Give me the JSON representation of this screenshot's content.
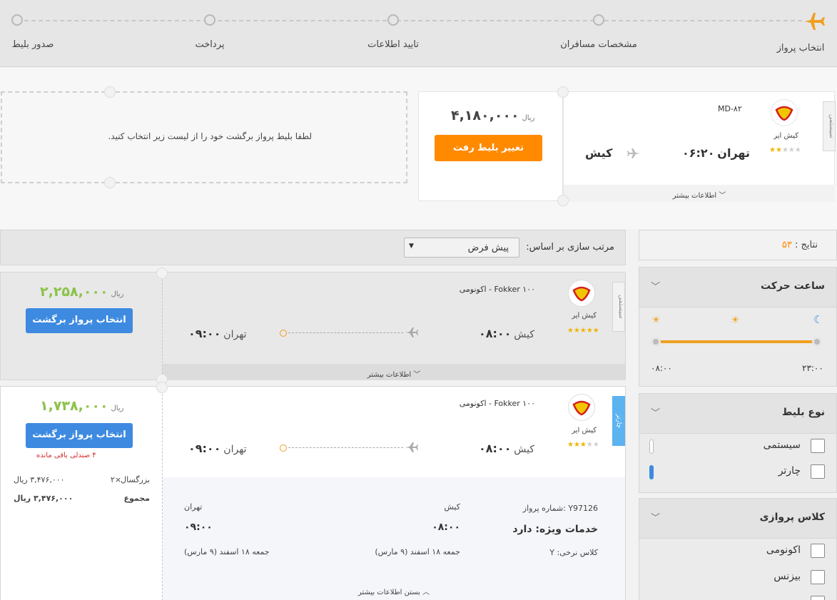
{
  "steps": [
    "انتخاب پرواز",
    "مشخصات مسافران",
    "تایید اطلاعات",
    "پرداخت",
    "صدور بلیط"
  ],
  "colors": {
    "accent": "#ff8a00",
    "primary": "#3d8ae0",
    "price": "#8bc34a",
    "charter": "#5cb3f0"
  },
  "selected_outbound": {
    "tab": "سیستمی",
    "airline": "کیش ایر",
    "aircraft": "MD-۸۲",
    "origin": "تهران",
    "time": "۰۶:۲۰",
    "destination": "کیش",
    "price": "۴,۱۸۰,۰۰۰",
    "currency": "ریال",
    "change_button": "تغییر بلیط رفت",
    "more_info": "اطلاعات بیشتر",
    "stars": 2
  },
  "return_prompt": "لطفا بلیط پرواز برگشت خود را از لیست زیر انتخاب کنید.",
  "results_header": {
    "label": "نتایج :",
    "count": "۵۳"
  },
  "sort": {
    "label": "مرتب سازی بر اساس:",
    "value": "پیش فرض"
  },
  "filters": {
    "departure_time": {
      "title": "ساعت حرکت",
      "from": "۰۸:۰۰",
      "to": "۲۳:۰۰"
    },
    "ticket_type": {
      "title": "نوع بلیط",
      "options": [
        "سیستمی",
        "چارتر"
      ]
    },
    "flight_class": {
      "title": "کلاس پروازی",
      "options": [
        "اکونومی",
        "بیزنس"
      ]
    }
  },
  "flights": [
    {
      "tab": "سیستمی",
      "airline": "کیش ایر",
      "aircraft": "Fokker ۱۰۰",
      "cabin": "اکونومی",
      "origin": "کیش",
      "dep_time": "۰۸:۰۰",
      "destination": "تهران",
      "arr_time": "۰۹:۰۰",
      "price": "۲,۲۵۸,۰۰۰",
      "currency": "ریال",
      "select_button": "انتخاب پرواز برگشت",
      "more_info": "اطلاعات بیشتر",
      "stars": 5
    },
    {
      "tab": "چارتر",
      "airline": "کیش ایر",
      "aircraft": "Fokker ۱۰۰",
      "cabin": "اکونومی",
      "origin": "کیش",
      "dep_time": "۰۸:۰۰",
      "destination": "تهران",
      "arr_time": "۰۹:۰۰",
      "price": "۱,۷۳۸,۰۰۰",
      "currency": "ریال",
      "select_button": "انتخاب پرواز برگشت",
      "seats_left": "۴ صندلی باقی مانده",
      "adult_label": "بزرگسال",
      "adult_count": "۲×",
      "adult_price": "۳,۴۷۶,۰۰۰ ریال",
      "total_label": "مجموع",
      "total_price": "۳,۴۷۶,۰۰۰ ریال",
      "stars": 3,
      "details": {
        "flight_no": "شماره پرواز: Y97126",
        "services": "خدمات ویژه: دارد",
        "fare_class": "کلاس نرخی: Y",
        "origin": "کیش",
        "dep_time": "۰۸:۰۰",
        "dep_date": "جمعه ۱۸ اسفند (۹ مارس)",
        "destination": "تهران",
        "arr_time": "۰۹:۰۰",
        "arr_date": "جمعه ۱۸ اسفند (۹ مارس)",
        "close_more": "بستن اطلاعات بیشتر"
      }
    }
  ]
}
